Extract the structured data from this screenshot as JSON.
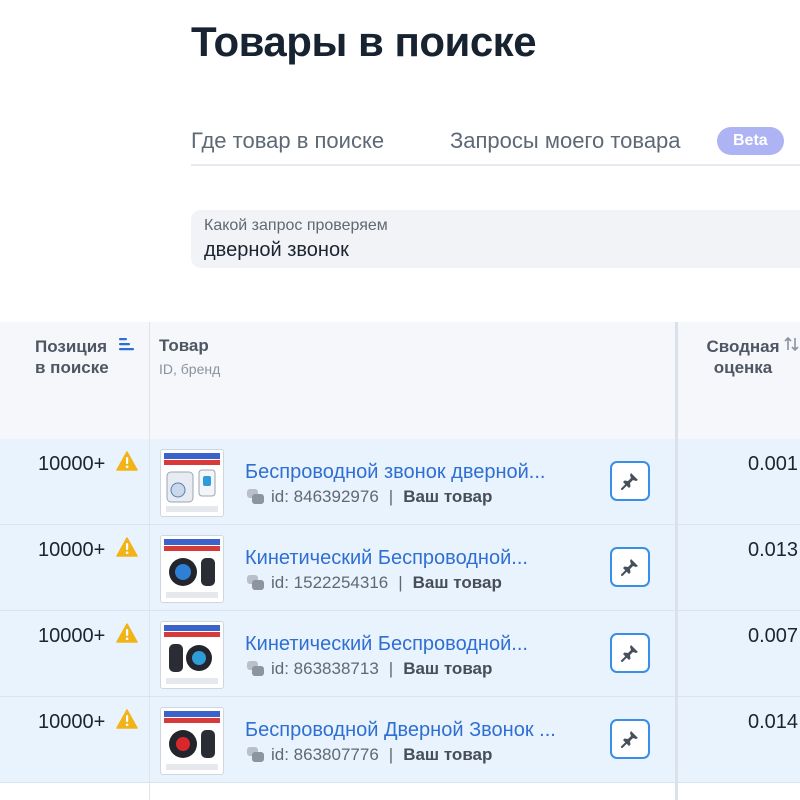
{
  "page": {
    "title": "Товары в поиске"
  },
  "tabs": [
    {
      "label": "Где товар в поиске"
    },
    {
      "label": "Запросы моего товара",
      "badge": "Beta"
    }
  ],
  "query": {
    "label": "Какой запрос проверяем",
    "value": "дверной звонок"
  },
  "table": {
    "headers": {
      "position": [
        "Позиция",
        "в поиске"
      ],
      "product": "Товар",
      "product_sub": "ID, бренд",
      "score": [
        "Сводная",
        "оценка"
      ]
    },
    "rows": [
      {
        "position": "10000+",
        "title": "Беспроводной звонок дверной...",
        "id": "id: 846392976",
        "badge": "Ваш товар",
        "score": "0.001"
      },
      {
        "position": "10000+",
        "title": "Кинетический Беспроводной...",
        "id": "id: 1522254316",
        "badge": "Ваш товар",
        "score": "0.013"
      },
      {
        "position": "10000+",
        "title": "Кинетический Беспроводной...",
        "id": "id: 863838713",
        "badge": "Ваш товар",
        "score": "0.007"
      },
      {
        "position": "10000+",
        "title": "Беспроводной Дверной Звонок ...",
        "id": "id: 863807776",
        "badge": "Ваш товар",
        "score": "0.014"
      }
    ]
  },
  "icons": {
    "sort": "sort-lines-icon",
    "sort_both": "sort-arrows-icon",
    "warning": "warning-icon",
    "chat": "chat-bubbles-icon",
    "pin": "pin-icon"
  },
  "colors": {
    "accent": "#2f6fd3",
    "row_bg": "#e9f3fd",
    "beta": "#aeb3f4",
    "warning": "#f2b319"
  }
}
